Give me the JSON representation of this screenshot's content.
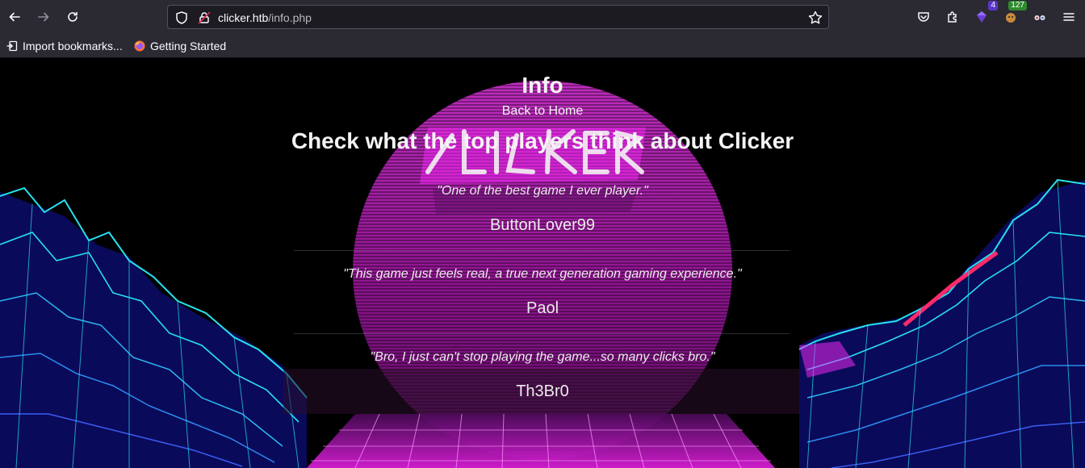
{
  "browser": {
    "url_host": "clicker.htb",
    "url_path": "/info.php",
    "extension_badges": [
      "4",
      "127"
    ],
    "bookmarks": [
      {
        "label": "Import bookmarks...",
        "icon": "import-icon"
      },
      {
        "label": "Getting Started",
        "icon": "firefox-icon"
      }
    ]
  },
  "page": {
    "title": "Info",
    "back_link": "Back to Home",
    "subtitle": "Check what the top players think about Clicker",
    "testimonials": [
      {
        "quote": "\"One of the best game I ever player.\"",
        "author": "ButtonLover99"
      },
      {
        "quote": "\"This game just feels real, a true next generation gaming experience.\"",
        "author": "Paol"
      },
      {
        "quote": "\"Bro, I just can't stop playing the game...so many clicks bro.\"",
        "author": "Th3Br0"
      }
    ]
  },
  "colors": {
    "chrome_bg": "#2b2a33",
    "urlbar_bg": "#1c1b22",
    "sun_magenta": "#e021e0",
    "grid_cyan": "#22d6e8",
    "grid_blue": "#1a1aa0"
  }
}
